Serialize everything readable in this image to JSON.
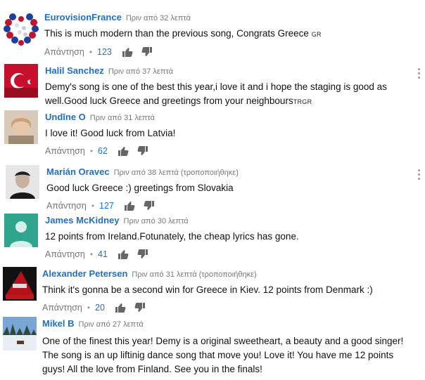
{
  "reply_label": "Απάντηση",
  "dot": "•",
  "comments": [
    {
      "author": "EurovisionFrance",
      "time": "Πριν από 32 λεπτά",
      "text": "This is much modern than the previous song, Congrats Greece",
      "cc": "GR",
      "likes": "123",
      "avatar_icon": "eurovision-heart-logo"
    },
    {
      "author": "Halil Sanchez",
      "time": "Πριν από 37 λεπτά",
      "text": "Demy's song is one of the best this year,i love it and i hope the staging is good as well.Good luck Greece and greetings from your neighbours",
      "cc": "TRGR",
      "likes": "",
      "avatar_icon": "turkish-flag-portrait"
    },
    {
      "author": "Undīne O",
      "time": "Πριν από 31 λεπτά",
      "text": "I love it! Good luck from Latvia!",
      "cc": "",
      "likes": "62",
      "avatar_icon": "portrait-photo"
    },
    {
      "author": "Marián Oravec",
      "time": "Πριν από 38 λεπτά (τροποποιήθηκε)",
      "text": "Good luck Greece :) greetings from Slovakia",
      "cc": "",
      "likes": "127",
      "avatar_icon": "portrait-photo"
    },
    {
      "author": "James McKidney",
      "time": "Πριν από 30 λεπτά",
      "text": "12 points from Ireland.Fotunately, the cheap lyrics has gone.",
      "cc": "",
      "likes": "41",
      "avatar_icon": "default-user-icon"
    },
    {
      "author": "Alexander Petersen",
      "time": "Πριν από 31 λεπτά (τροποποιήθηκε)",
      "text": "Think it's gonna be a second win for Greece in Kiev. 12 points from Denmark :)",
      "cc": "",
      "likes": "20",
      "avatar_icon": "album-art"
    },
    {
      "author": "Mikel B",
      "time": "Πριν από 27 λεπτά",
      "text": "One of the finest this year! Demy is a original sweetheart, a beauty and a good singer! The song is an up liftinig dance song that move you! Love it! You have me 12 points guys! All the love from Finland. See you in the finals!",
      "cc": "",
      "likes": "",
      "avatar_icon": "winter-landscape"
    }
  ],
  "colors": {
    "author": "#1f6fc4",
    "meta": "#777777",
    "text": "#111111"
  }
}
